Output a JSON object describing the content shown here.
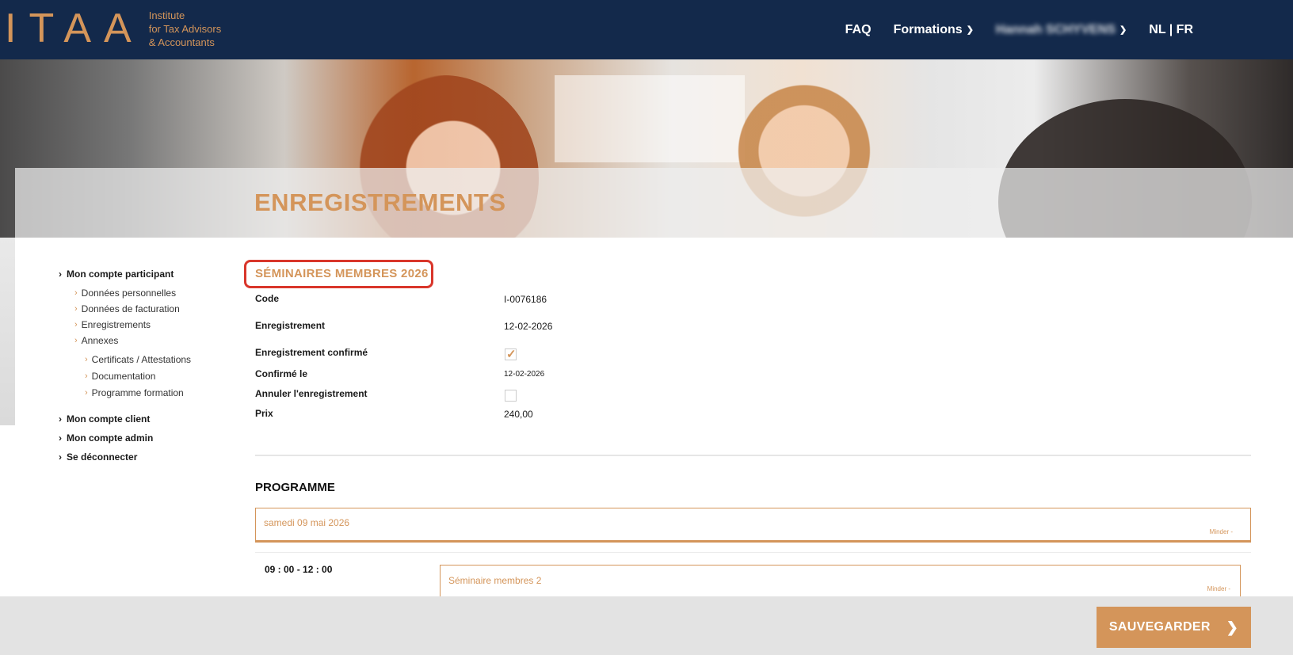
{
  "header": {
    "logo_mark": "ITAA",
    "logo_lines": [
      "Institute",
      "for Tax Advisors",
      "& Accountants"
    ],
    "nav": {
      "faq": "FAQ",
      "formations": "Formations",
      "user": "Hannah SCHYVENS",
      "lang": "NL | FR"
    }
  },
  "page_title": "ENREGISTREMENTS",
  "sidebar": {
    "participant": "Mon compte participant",
    "items": [
      "Données personnelles",
      "Données de facturation",
      "Enregistrements",
      "Annexes"
    ],
    "annexes": [
      "Certificats / Attestations",
      "Documentation",
      "Programme formation"
    ],
    "client": "Mon compte client",
    "admin": "Mon compte admin",
    "logout": "Se déconnecter"
  },
  "detail": {
    "section_title": "SÉMINAIRES MEMBRES 2026",
    "code_label": "Code",
    "code_value": "I-0076186",
    "registration_label": "Enregistrement",
    "registration_value": "12-02-2026",
    "confirmed_label": "Enregistrement confirmé",
    "confirmed_checked": true,
    "confirmed_on_label": "Confirmé le",
    "confirmed_on_value": "12-02-2026",
    "cancel_label": "Annuler l'enregistrement",
    "cancel_checked": false,
    "price_label": "Prix",
    "price_value": "240,00"
  },
  "programme": {
    "title": "PROGRAMME",
    "day": "samedi 09 mai 2026",
    "minder": "Minder -",
    "time": "09 : 00 - 12 : 00",
    "session": "Séminaire membres 2",
    "session_minder": "Minder -"
  },
  "footer": {
    "save_label": "SAUVEGARDER"
  },
  "colors": {
    "navy": "#13294b",
    "accent": "#d4955a",
    "highlight": "#d9362b"
  }
}
